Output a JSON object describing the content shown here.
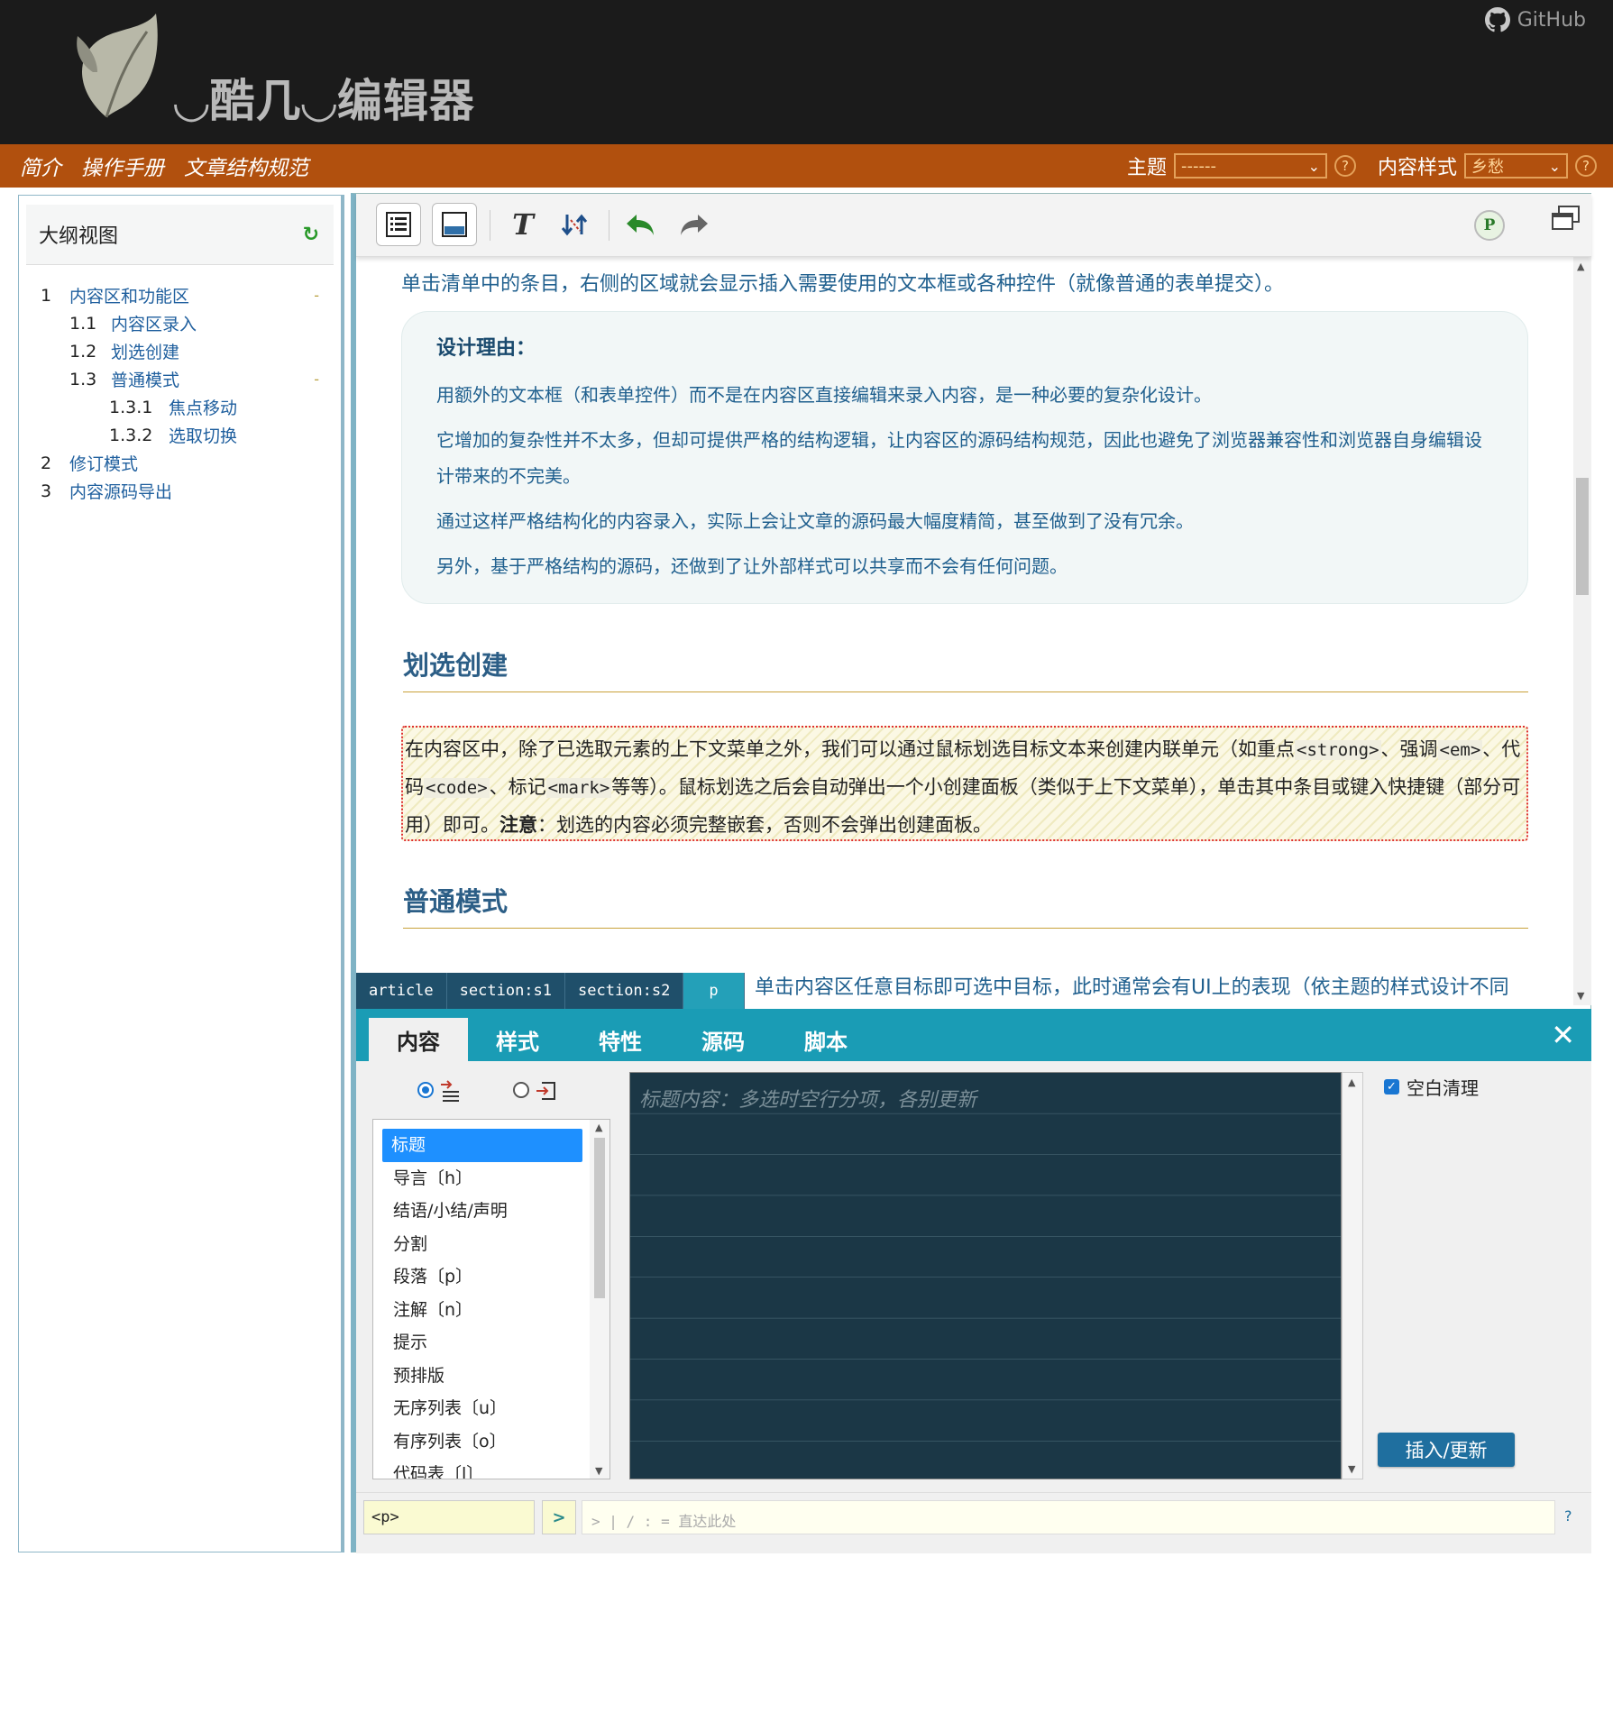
{
  "header": {
    "logo_text": "◡酷几◡编辑器",
    "github_label": "GitHub"
  },
  "nav": {
    "links": [
      "简介",
      "操作手册",
      "文章结构规范"
    ],
    "theme_label": "主题",
    "theme_value": "------",
    "content_style_label": "内容样式",
    "content_style_value": "乡愁",
    "help": "?"
  },
  "outline": {
    "title": "大纲视图",
    "refresh_icon": "↻",
    "items": [
      {
        "num": "1",
        "text": "内容区和功能区",
        "dash": "-"
      },
      {
        "num": "1.1",
        "text": "内容区录入"
      },
      {
        "num": "1.2",
        "text": "划选创建"
      },
      {
        "num": "1.3",
        "text": "普通模式",
        "dash": "-"
      },
      {
        "num": "1.3.1",
        "text": "焦点移动"
      },
      {
        "num": "1.3.2",
        "text": "选取切换"
      },
      {
        "num": "2",
        "text": "修订模式"
      },
      {
        "num": "3",
        "text": "内容源码导出"
      }
    ]
  },
  "toolbar": {
    "p_badge": "P",
    "icons": [
      "outline-view-icon",
      "split-view-icon",
      "text-format-icon",
      "swap-icon",
      "undo-icon",
      "redo-icon",
      "window-icon"
    ]
  },
  "content": {
    "intro": "单击清单中的条目，右侧的区域就会显示插入需要使用的文本框或各种控件（就像普通的表单提交）。",
    "design_title": "设计理由：",
    "design_paras": [
      "用额外的文本框（和表单控件）而不是在内容区直接编辑来录入内容，是一种必要的复杂化设计。",
      "它增加的复杂性并不太多，但却可提供严格的结构逻辑，让内容区的源码结构规范，因此也避免了浏览器兼容性和浏览器自身编辑设计带来的不完美。",
      "通过这样严格结构化的内容录入，实际上会让文章的源码最大幅度精简，甚至做到了没有冗余。",
      "另外，基于严格结构的源码，还做到了让外部样式可以共享而不会有任何问题。"
    ],
    "h_select": "划选创建",
    "select_text": {
      "a": "在内容区中，除了已选取元素的上下文菜单之外，我们可以通过鼠标划选目标文本来创建内联单元（如重点",
      "code1": "<strong>",
      "b": "、强调",
      "code2": "<em>",
      "c": "、代码",
      "code3": "<code>",
      "d": "、标记",
      "code4": "<mark>",
      "e": "等等）。鼠标划选之后会自动弹出一个小创建面板（类似于上下文菜单），单击其中条目或键入快捷键（部分可用）即可。",
      "strong": "注意",
      "f": "：划选的内容必须完整嵌套，否则不会弹出创建面板。"
    },
    "h_normal": "普通模式",
    "trail": "单击内容区任意目标即可选中目标，此时通常会有UI上的表现（依主题的样式设计不同"
  },
  "breadcrumb": [
    "article",
    "section:s1",
    "section:s2",
    "p"
  ],
  "panel": {
    "tabs": [
      "内容",
      "样式",
      "特性",
      "源码",
      "脚本"
    ],
    "close_icon": "✕",
    "types": [
      "标题",
      "导言〔h〕",
      "结语/小结/声明",
      "分割",
      "段落〔p〕",
      "注解〔n〕",
      "提示",
      "预排版",
      "无序列表〔u〕",
      "有序列表〔o〕",
      "代码表〔l〕"
    ],
    "textarea_placeholder": "标题内容：多选时空行分项，各别更新",
    "ws_clean_label": "空白清理",
    "insert_button": "插入/更新"
  },
  "cmdbar": {
    "tag": "<p>",
    "go": ">",
    "placeholder": "> | / : = 直达此处",
    "help": "?"
  },
  "colors": {
    "header_bg": "#1b1b1b",
    "nav_bg": "#b1500e",
    "panel_accent": "#1a9cb5",
    "heading": "#2c5e86"
  }
}
